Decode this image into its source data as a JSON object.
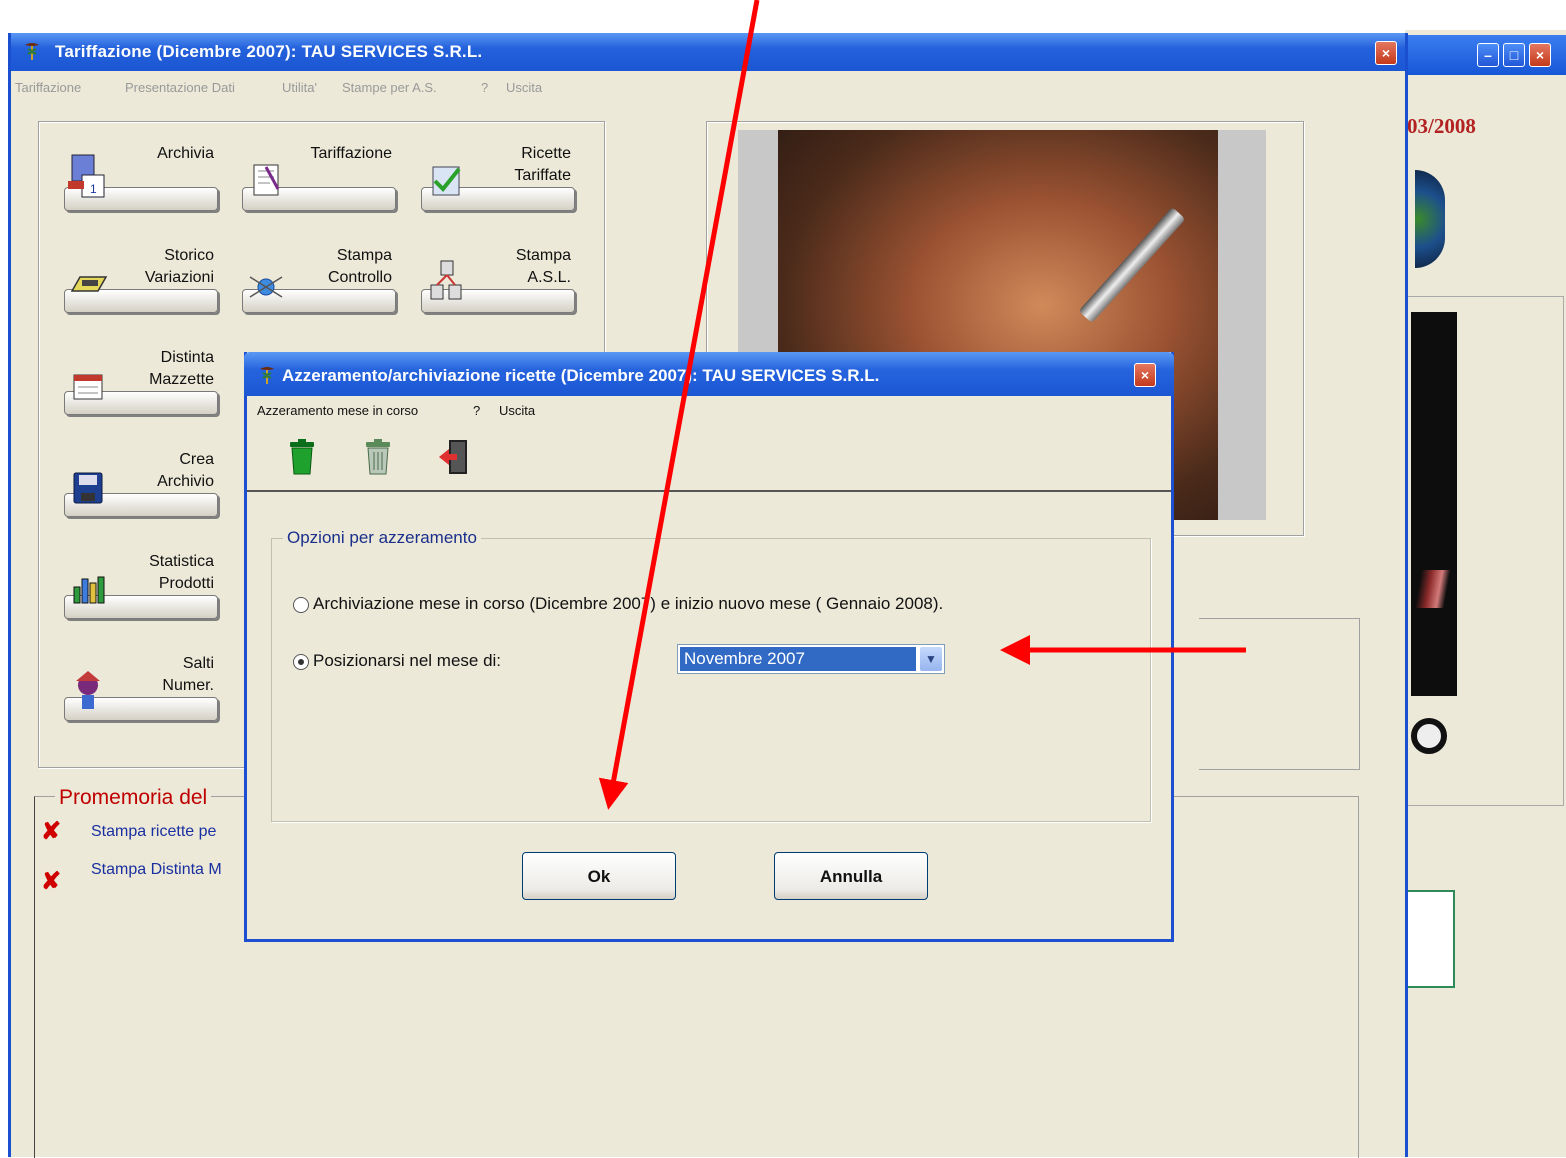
{
  "background_window": {
    "date_fragment": "03/2008",
    "controls": [
      "minimize",
      "maximize",
      "close"
    ]
  },
  "main_window": {
    "title": "Tariffazione (Dicembre 2007): TAU SERVICES S.R.L.",
    "menu": [
      "Tariffazione",
      "Presentazione Dati",
      "Utilita'",
      "Stampe per A.S.",
      "?",
      "Uscita"
    ],
    "buttons": [
      {
        "lines": [
          "Archivia"
        ],
        "icon": "calendar-icon"
      },
      {
        "lines": [
          "Tariffazione"
        ],
        "icon": "document-pen-icon"
      },
      {
        "lines": [
          "Ricette",
          "Tariffate"
        ],
        "icon": "checked-documents-icon"
      },
      {
        "lines": [
          "Storico",
          "Variazioni"
        ],
        "icon": "ticket-icon"
      },
      {
        "lines": [
          "Stampa",
          "Controllo"
        ],
        "icon": "network-icon"
      },
      {
        "lines": [
          "Stampa",
          "A.S.L."
        ],
        "icon": "database-network-icon"
      },
      {
        "lines": [
          "Distinta",
          "Mazzette"
        ],
        "icon": "calendar-sheet-icon"
      },
      {
        "lines": [
          "Crea",
          "Archivio"
        ],
        "icon": "floppy-disk-icon"
      },
      {
        "lines": [
          "Statistica",
          "Prodotti"
        ],
        "icon": "bar-chart-icon"
      },
      {
        "lines": [
          "Salti",
          "Numer."
        ],
        "icon": "jester-icon"
      }
    ],
    "memo": {
      "title": "Promemoria del",
      "items": [
        "Stampa ricette pe",
        "Stampa Distinta M"
      ]
    }
  },
  "dialog": {
    "title": "Azzeramento/archiviazione ricette (Dicembre  2007): TAU SERVICES S.R.L.",
    "menu": [
      "Azzeramento mese in corso",
      "?",
      "Uscita"
    ],
    "toolbar": [
      {
        "icon": "green-trash-icon"
      },
      {
        "icon": "grey-trash-icon"
      },
      {
        "icon": "exit-door-icon"
      }
    ],
    "options_group": "Opzioni per azzeramento",
    "option_archive": "Archiviazione mese in corso (Dicembre  2007) e inizio nuovo mese ( Gennaio  2008).",
    "option_position": "Posizionarsi nel mese di:",
    "selected_option": "position",
    "month_select_value": "Novembre  2007",
    "ok_label": "Ok",
    "cancel_label": "Annulla"
  },
  "annotation_color": "#ff0000"
}
